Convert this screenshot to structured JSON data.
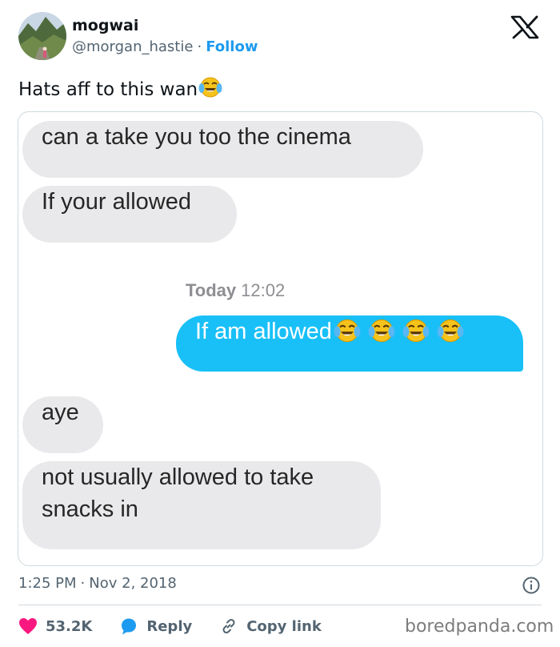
{
  "author": {
    "name": "mogwai",
    "handle": "@morgan_hastie",
    "separator": "·",
    "follow_label": "Follow",
    "avatar_icon": "avatar-landscape-photo"
  },
  "brand": {
    "logo_icon": "x-logo-icon"
  },
  "tweet": {
    "text": "Hats aff to this wan",
    "emoji": "face-with-tears-of-joy"
  },
  "screenshot": {
    "messages": [
      {
        "direction": "received",
        "text": "can a take you too the cinema"
      },
      {
        "direction": "received",
        "text": "If your allowed"
      },
      {
        "direction": "sent",
        "text": "If am allowed",
        "emoji_count": 4
      },
      {
        "direction": "received",
        "text": "aye"
      },
      {
        "direction": "received",
        "lines": [
          "not usually allowed to take",
          "snacks in"
        ]
      }
    ],
    "timestamp": {
      "day": "Today",
      "time": "12:02"
    },
    "colors": {
      "received_bubble": "#e9e9eb",
      "sent_bubble": "#19c0f7"
    }
  },
  "meta": {
    "time": "1:25 PM",
    "separator": "·",
    "date": "Nov 2, 2018",
    "info_icon": "info-icon"
  },
  "actions": {
    "like": {
      "count": "53.2K",
      "icon": "heart-icon",
      "color": "#f91880"
    },
    "reply": {
      "label": "Reply",
      "icon": "reply-bubble-icon",
      "color": "#1d9bf0"
    },
    "copy": {
      "label": "Copy link",
      "icon": "link-icon"
    }
  },
  "watermark": "boredpanda.com",
  "colors": {
    "accent": "#1d9bf0",
    "text": "#0f1419",
    "muted": "#536471"
  }
}
